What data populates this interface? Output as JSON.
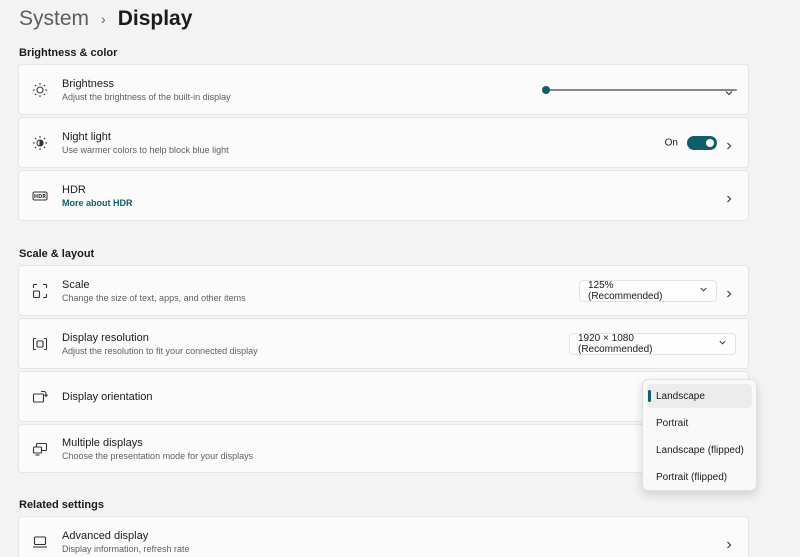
{
  "breadcrumb": {
    "parent": "System",
    "separator": "›",
    "current": "Display"
  },
  "sections": {
    "brightness_color": "Brightness & color",
    "scale_layout": "Scale & layout",
    "related": "Related settings"
  },
  "brightness": {
    "title": "Brightness",
    "subtitle": "Adjust the brightness of the built-in display",
    "level": 0
  },
  "night_light": {
    "title": "Night light",
    "subtitle": "Use warmer colors to help block blue light",
    "state": "On",
    "enabled": true
  },
  "hdr": {
    "title": "HDR",
    "link": "More about HDR"
  },
  "scale": {
    "title": "Scale",
    "subtitle": "Change the size of text, apps, and other items",
    "value": "125% (Recommended)"
  },
  "resolution": {
    "title": "Display resolution",
    "subtitle": "Adjust the resolution to fit your connected display",
    "value": "1920 × 1080 (Recommended)"
  },
  "orientation": {
    "title": "Display orientation",
    "options": [
      "Landscape",
      "Portrait",
      "Landscape (flipped)",
      "Portrait (flipped)"
    ],
    "selected": "Landscape"
  },
  "multiple_displays": {
    "title": "Multiple displays",
    "subtitle": "Choose the presentation mode for your displays"
  },
  "advanced_display": {
    "title": "Advanced display",
    "subtitle": "Display information, refresh rate"
  },
  "icons": {
    "brightness": "sun-icon",
    "night_light": "night-light-icon",
    "hdr": "hdr-icon",
    "scale": "scale-icon",
    "resolution": "resolution-icon",
    "orientation": "orientation-icon",
    "multiple_displays": "multiple-displays-icon",
    "advanced_display": "laptop-icon"
  },
  "colors": {
    "accent": "#0f5e6c",
    "background": "#f3f3f3",
    "card": "#fbfbfb"
  }
}
